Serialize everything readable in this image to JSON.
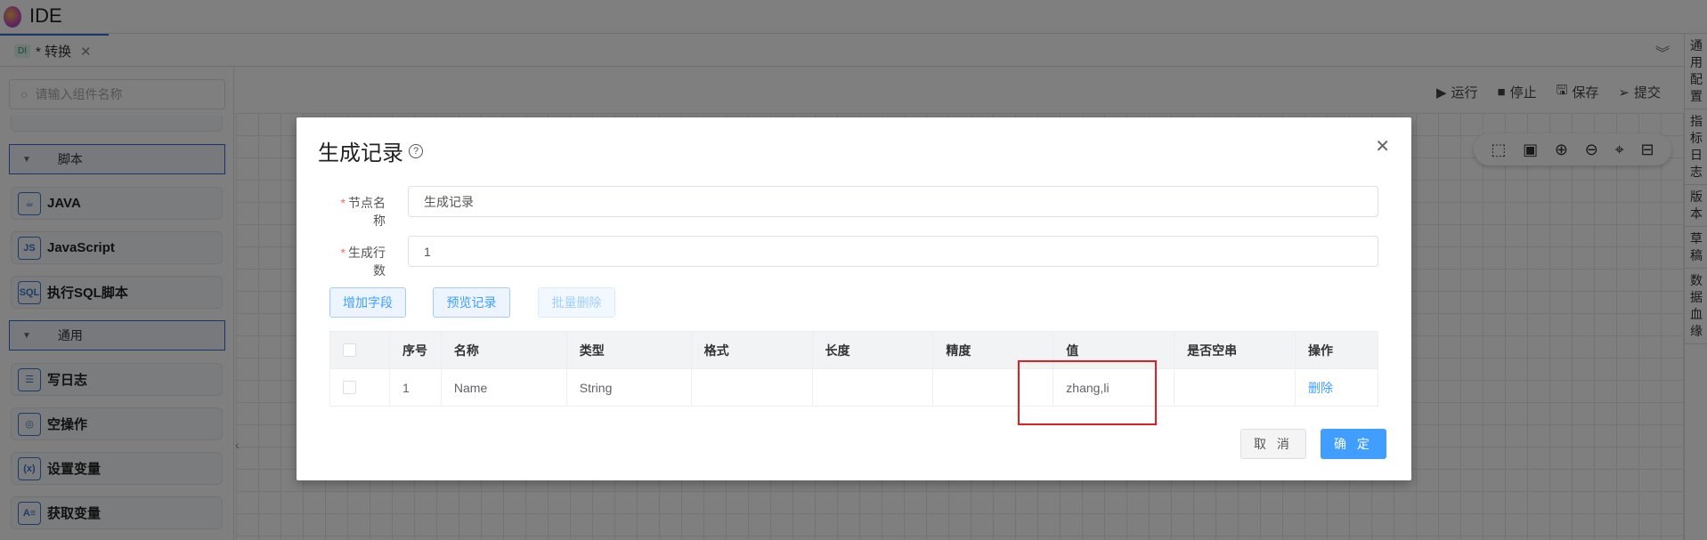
{
  "app": {
    "title": "IDE"
  },
  "tabs": [
    {
      "badge": "DI",
      "label": "* 转换"
    }
  ],
  "right_panel": [
    "通用配置",
    "指标日志",
    "版本",
    "草稿",
    "数据血缘"
  ],
  "sidebar": {
    "search_placeholder": "请输入组件名称",
    "groups": [
      {
        "label": "脚本",
        "items": [
          {
            "label": "JAVA",
            "icon": "java-icon",
            "glyph": "☕"
          },
          {
            "label": "JavaScript",
            "icon": "js-icon",
            "glyph": "JS"
          },
          {
            "label": "执行SQL脚本",
            "icon": "sql-file-icon",
            "glyph": "SQL"
          }
        ]
      },
      {
        "label": "通用",
        "items": [
          {
            "label": "写日志",
            "icon": "log-icon",
            "glyph": "☰"
          },
          {
            "label": "空操作",
            "icon": "empty-op-icon",
            "glyph": "◎"
          },
          {
            "label": "设置变量",
            "icon": "set-variable-icon",
            "glyph": "(x)"
          },
          {
            "label": "获取变量",
            "icon": "get-variable-icon",
            "glyph": "A≡"
          }
        ]
      }
    ]
  },
  "toolbar": {
    "run": "运行",
    "stop": "停止",
    "save": "保存",
    "submit": "提交"
  },
  "modal": {
    "title": "生成记录",
    "fields": [
      {
        "label": "节点名称",
        "value": "生成记录",
        "required": true
      },
      {
        "label": "生成行数",
        "value": "1",
        "required": true
      }
    ],
    "buttons": {
      "add_field": "增加字段",
      "preview": "预览记录",
      "batch_delete": "批量删除"
    },
    "table": {
      "headers": [
        "",
        "序号",
        "名称",
        "类型",
        "格式",
        "长度",
        "精度",
        "值",
        "是否空串",
        "操作"
      ],
      "rows": [
        [
          "",
          "1",
          "Name",
          "String",
          "",
          "",
          "",
          "zhang,li",
          "",
          "删除"
        ]
      ]
    },
    "footer": {
      "cancel": "取 消",
      "ok": "确 定"
    }
  },
  "colors": {
    "primary": "#409eff",
    "highlight": "#e02020",
    "accent": "#2f6fd6"
  }
}
